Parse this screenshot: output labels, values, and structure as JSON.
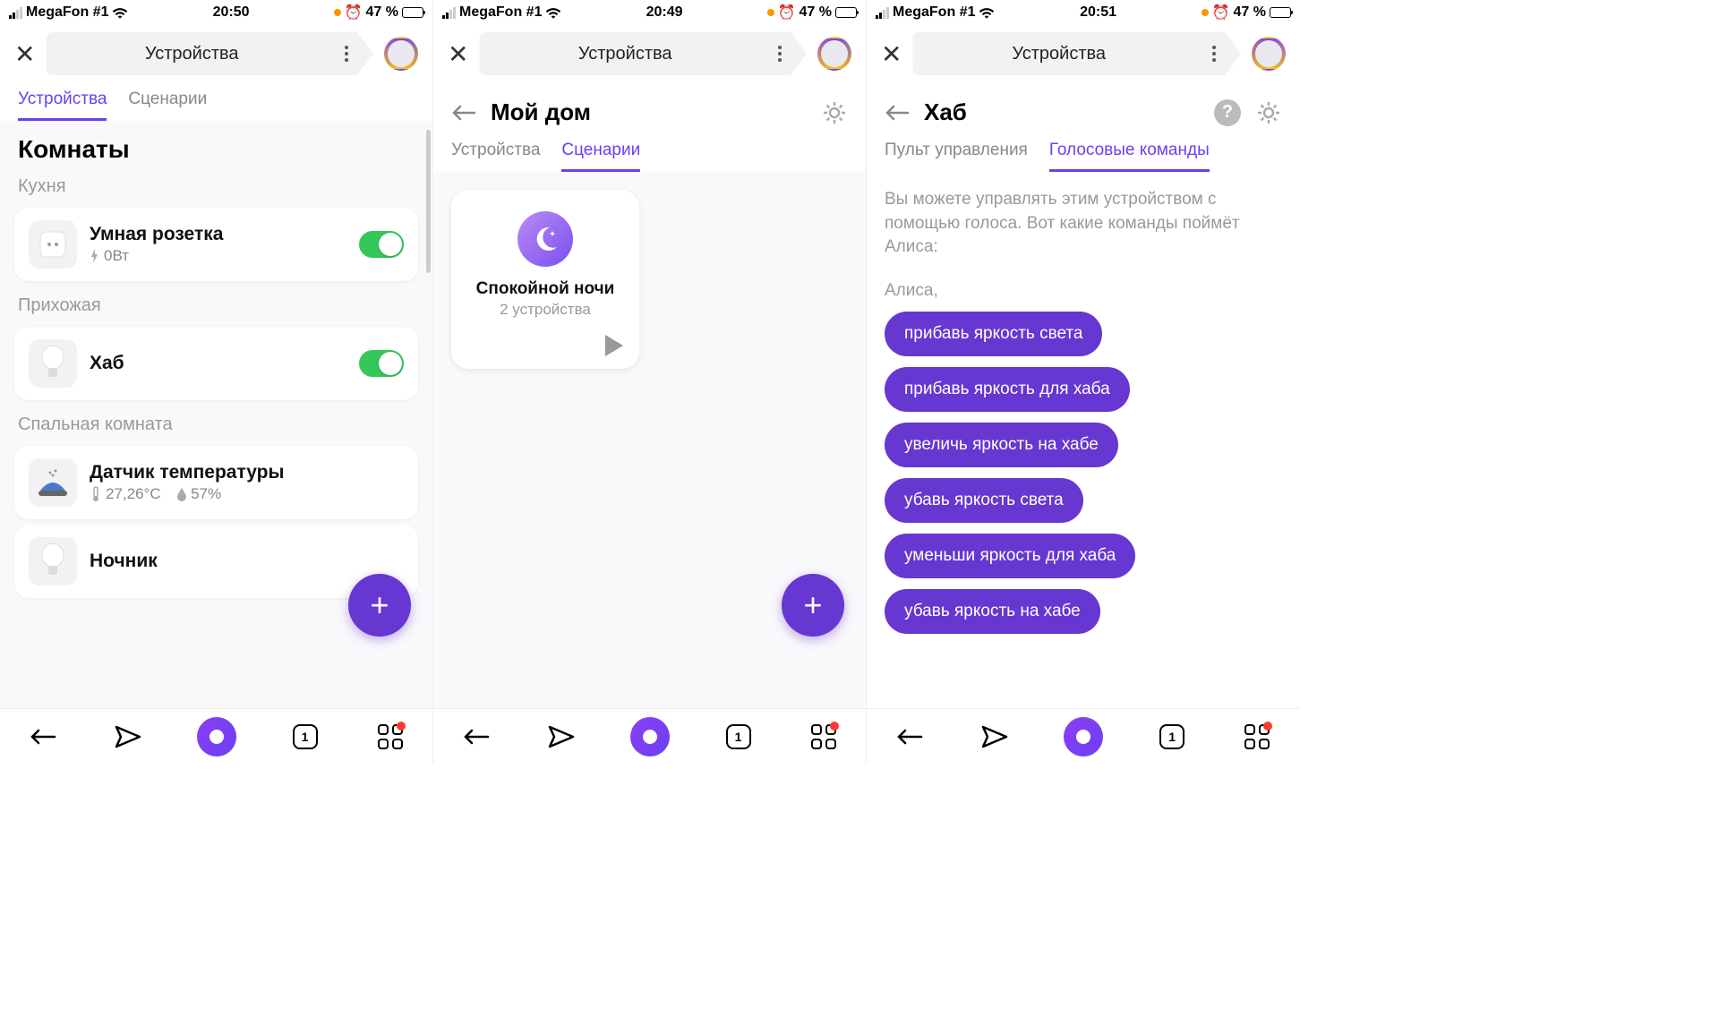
{
  "status": {
    "carrier": "MegaFon #1",
    "battery": "47 %",
    "times": [
      "20:50",
      "20:49",
      "20:51"
    ]
  },
  "header": {
    "title": "Устройства"
  },
  "screen1": {
    "tabs": [
      "Устройства",
      "Сценарии"
    ],
    "section": "Комнаты",
    "rooms": [
      {
        "name": "Кухня",
        "devices": [
          {
            "name": "Умная розетка",
            "sub": "0Вт",
            "toggle": true,
            "icon": "socket"
          }
        ]
      },
      {
        "name": "Прихожая",
        "devices": [
          {
            "name": "Хаб",
            "toggle": true,
            "icon": "bulb"
          }
        ]
      },
      {
        "name": "Спальная комната",
        "devices": [
          {
            "name": "Датчик температуры",
            "temp": "27,26°C",
            "humidity": "57%",
            "icon": "sensor"
          },
          {
            "name": "Ночник",
            "icon": "bulb"
          }
        ]
      }
    ]
  },
  "screen2": {
    "title": "Мой дом",
    "tabs": [
      "Устройства",
      "Сценарии"
    ],
    "scenario": {
      "name": "Спокойной ночи",
      "sub": "2 устройства"
    }
  },
  "screen3": {
    "title": "Хаб",
    "tabs": [
      "Пульт управления",
      "Голосовые команды"
    ],
    "intro": "Вы можете управлять этим устройством с помощью голоса. Вот какие команды поймёт Алиса:",
    "label": "Алиса,",
    "commands": [
      "прибавь яркость света",
      "прибавь яркость для хаба",
      "увеличь яркость на хабе",
      "убавь яркость света",
      "уменьши яркость для хаба",
      "убавь яркость на хабе"
    ]
  },
  "bottomNav": {
    "count": "1"
  }
}
